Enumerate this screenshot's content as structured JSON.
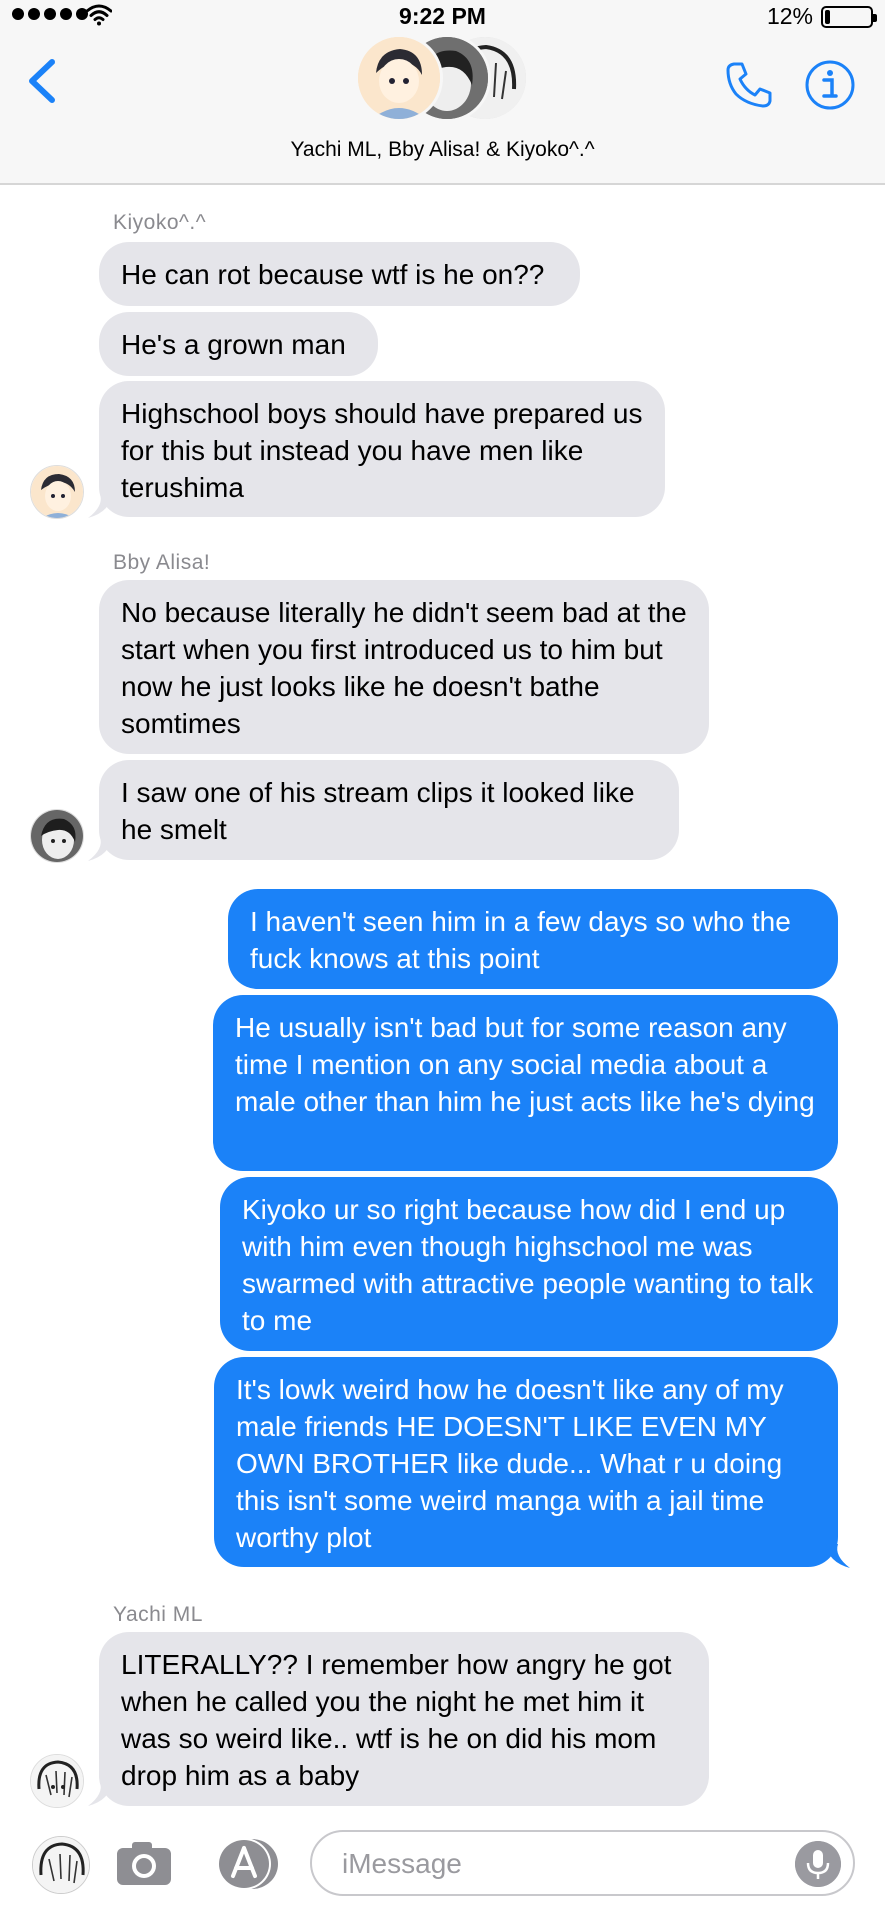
{
  "status_bar": {
    "time": "9:22 PM",
    "battery_percent_text": "12%",
    "battery_level": 0.12
  },
  "header": {
    "title": "Yachi ML, Bby Alisa! & Kiyoko^.^"
  },
  "colors": {
    "incoming_bubble": "#e5e5ea",
    "outgoing_bubble": "#1b82f8",
    "accent": "#1b82f8",
    "sender_label": "#8a8a8f"
  },
  "icons": {
    "back": "chevron-left-icon",
    "call": "phone-icon",
    "info": "info-icon",
    "camera": "camera-icon",
    "apps": "app-store-icon",
    "mic": "microphone-icon"
  },
  "messages": {
    "group1": {
      "sender": "Kiyoko^.^",
      "m1": "He can rot because wtf is he on??",
      "m2": "He's a grown man",
      "m3": "Highschool boys should have prepared us for this but instead you have men like terushima"
    },
    "group2": {
      "sender": "Bby Alisa!",
      "m1": "No because literally he didn't seem bad at the start when you first introduced us to him but now he just looks like he doesn't bathe somtimes",
      "m2": "I saw one of his stream clips it looked like he smelt"
    },
    "outgoing": {
      "m1": "I haven't seen him in a few days so who the fuck knows at this point",
      "m2": "He usually isn't bad but for some reason any time I mention on any social media about a male other than him he just acts like he's dying",
      "m3": "Kiyoko ur so right because how did I end up with him even though highschool me was swarmed with attractive people wanting to talk to me",
      "m4": "It's lowk weird how he doesn't like any of my male friends HE DOESN'T LIKE EVEN MY OWN BROTHER like dude... What r u doing this isn't some weird manga with a jail time worthy plot"
    },
    "group3": {
      "sender": "Yachi ML",
      "m1": "LITERALLY?? I remember how angry he got when he called you the night he met him it was so weird like.. wtf is he on did his mom drop him as a baby"
    }
  },
  "input": {
    "placeholder": "iMessage"
  }
}
